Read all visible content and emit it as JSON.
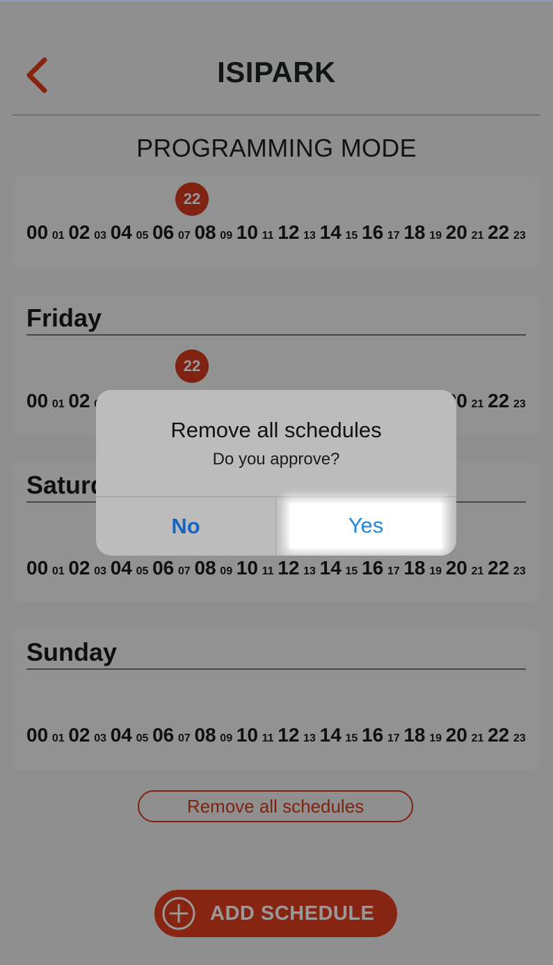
{
  "header": {
    "title": "ISIPARK",
    "subtitle": "PROGRAMMING MODE"
  },
  "hours": [
    "00",
    "01",
    "02",
    "03",
    "04",
    "05",
    "06",
    "07",
    "08",
    "09",
    "10",
    "11",
    "12",
    "13",
    "14",
    "15",
    "16",
    "17",
    "18",
    "19",
    "20",
    "21",
    "22",
    "23"
  ],
  "days": [
    {
      "name": "",
      "badge": "22"
    },
    {
      "name": "Friday",
      "badge": "22"
    },
    {
      "name": "Saturday",
      "badge": ""
    },
    {
      "name": "Sunday",
      "badge": ""
    }
  ],
  "actions": {
    "remove_all_label": "Remove all schedules",
    "add_schedule_label": "ADD SCHEDULE"
  },
  "dialog": {
    "title": "Remove all schedules",
    "message": "Do you approve?",
    "no_label": "No",
    "yes_label": "Yes"
  },
  "colors": {
    "accent": "#e33e1f",
    "dialog_button": "#1565c0"
  }
}
